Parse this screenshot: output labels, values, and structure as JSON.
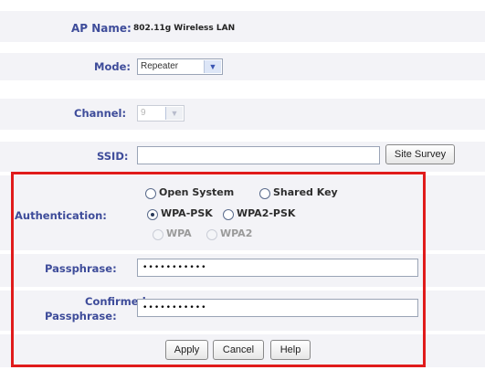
{
  "ap_name": {
    "label": "AP Name:",
    "value": "802.11g Wireless LAN"
  },
  "mode": {
    "label": "Mode:",
    "selected": "Repeater"
  },
  "channel": {
    "label": "Channel:",
    "selected": "9"
  },
  "ssid": {
    "label": "SSID:",
    "value": "",
    "site_survey_label": "Site Survey"
  },
  "authentication": {
    "label": "Authentication:",
    "options": [
      {
        "label": "Open System",
        "checked": false,
        "disabled": false
      },
      {
        "label": "Shared Key",
        "checked": false,
        "disabled": false
      },
      {
        "label": "WPA-PSK",
        "checked": true,
        "disabled": false
      },
      {
        "label": "WPA2-PSK",
        "checked": false,
        "disabled": false
      },
      {
        "label": "WPA",
        "checked": false,
        "disabled": true
      },
      {
        "label": "WPA2",
        "checked": false,
        "disabled": true
      }
    ]
  },
  "passphrase": {
    "label": "Passphrase:",
    "masked_value": "•••••••••••"
  },
  "confirmed": {
    "label_line1": "Confirmed",
    "label_line2": "Passphrase:",
    "masked_value": "•••••••••••"
  },
  "buttons": {
    "apply": "Apply",
    "cancel": "Cancel",
    "help": "Help"
  },
  "colors": {
    "label": "#3e4c9a",
    "highlight": "#e01b1b",
    "band": "#f3f3f7"
  },
  "icons": {
    "dropdown": "chevron-down-icon"
  }
}
